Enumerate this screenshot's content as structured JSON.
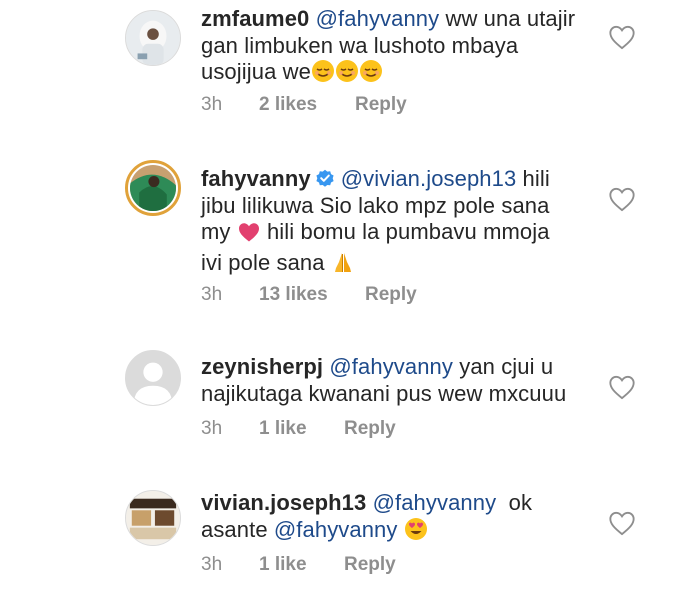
{
  "comments": [
    {
      "username": "zmfaume0",
      "mention": "@fahyvanny",
      "text_line1": "ww una utajir",
      "text_line2": "gan limbuken wa lushoto mbaya",
      "text_line3": "usojijua we",
      "time": "3h",
      "likes": "2 likes",
      "reply": "Reply"
    },
    {
      "username": "fahyvanny",
      "mention": "@vivian.joseph13",
      "text_line1": "hili",
      "text_line2": "jibu lilikuwa Sio lako mpz pole sana",
      "text_line3a": "my",
      "text_line3b": "hili bomu la pumbavu mmoja",
      "text_line4": "ivi pole sana",
      "time": "3h",
      "likes": "13 likes",
      "reply": "Reply"
    },
    {
      "username": "zeynisherpj",
      "mention": "@fahyvanny",
      "text_line1": "yan cjui u",
      "text_line2": "najikutaga kwanani pus wew mxcuuu",
      "time": "3h",
      "likes": "1 like",
      "reply": "Reply"
    },
    {
      "username": "vivian.joseph13",
      "mention": "@fahyvanny",
      "text_line1": "ok",
      "text_line2": "asante",
      "mention2": "@fahyvanny",
      "time": "3h",
      "likes": "1 like",
      "reply": "Reply"
    }
  ],
  "colors": {
    "mention": "#1e4a8a",
    "meta": "#8e8e8e",
    "heart_inline": "#e2406f",
    "verified": "#3897f0"
  },
  "icons": [
    "heart-outline-icon",
    "verified-badge-icon",
    "smiling-face-emoji",
    "heart-eyes-emoji",
    "folded-hands-emoji",
    "heart-emoji",
    "default-avatar-icon"
  ]
}
